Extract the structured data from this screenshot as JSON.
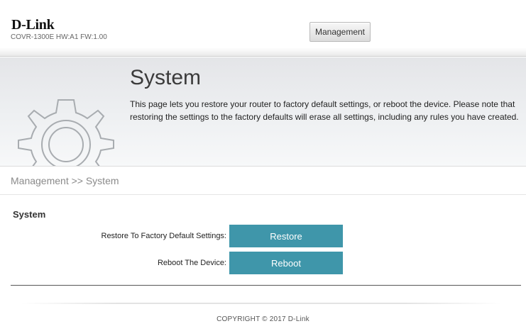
{
  "header": {
    "brand": "D-Link",
    "model_info": "COVR-1300E HW:A1 FW:1.00",
    "nav_button": "Management"
  },
  "banner": {
    "icon": "gear-icon",
    "title": "System",
    "description": "This page lets you restore your router to factory default settings, or reboot the device. Please note that restoring the settings to the factory defaults will erase all settings, including any rules you have created."
  },
  "breadcrumb": "Management >> System",
  "section": {
    "title": "System",
    "rows": [
      {
        "label": "Restore To Factory Default Settings:",
        "button": "Restore"
      },
      {
        "label": "Reboot The Device:",
        "button": "Reboot"
      }
    ]
  },
  "footer": {
    "copyright": "COPYRIGHT © 2017 D-Link"
  },
  "colors": {
    "button_bg": "#3f96aa",
    "button_text": "#ffffff"
  }
}
